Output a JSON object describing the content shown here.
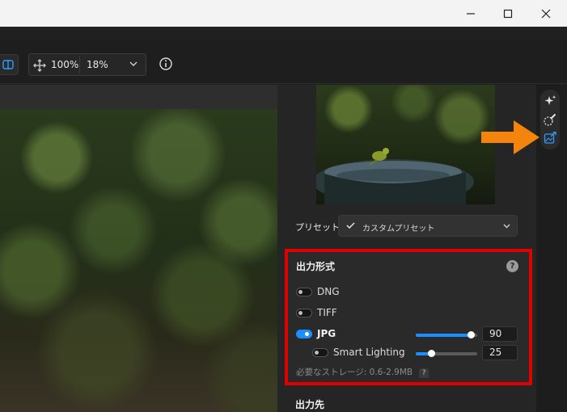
{
  "window": {
    "minimize_icon": "minimize-icon",
    "maximize_icon": "maximize-icon",
    "close_icon": "close-icon"
  },
  "toolbar": {
    "zoom_fit": "100%",
    "zoom_value": "18%"
  },
  "panel": {
    "preset_label": "プリセット",
    "preset_value": "カスタムプリセット",
    "output_format": {
      "title": "出力形式",
      "help": "?",
      "dng_label": "DNG",
      "dng_enabled": false,
      "tiff_label": "TIFF",
      "tiff_enabled": false,
      "jpg_label": "JPG",
      "jpg_enabled": true,
      "jpg_quality": "90",
      "jpg_quality_fraction": 0.9,
      "smart_lighting_label": "Smart Lighting",
      "smart_lighting_enabled": false,
      "smart_lighting_value": "25",
      "smart_lighting_fraction": 0.25,
      "storage_text": "必要なストレージ: 0.6-2.9MB",
      "storage_help": "?"
    },
    "destination_title": "出力先"
  },
  "colors": {
    "accent": "#1a8fff",
    "highlight_box": "#e00000",
    "pointer_arrow": "#f5840c"
  }
}
